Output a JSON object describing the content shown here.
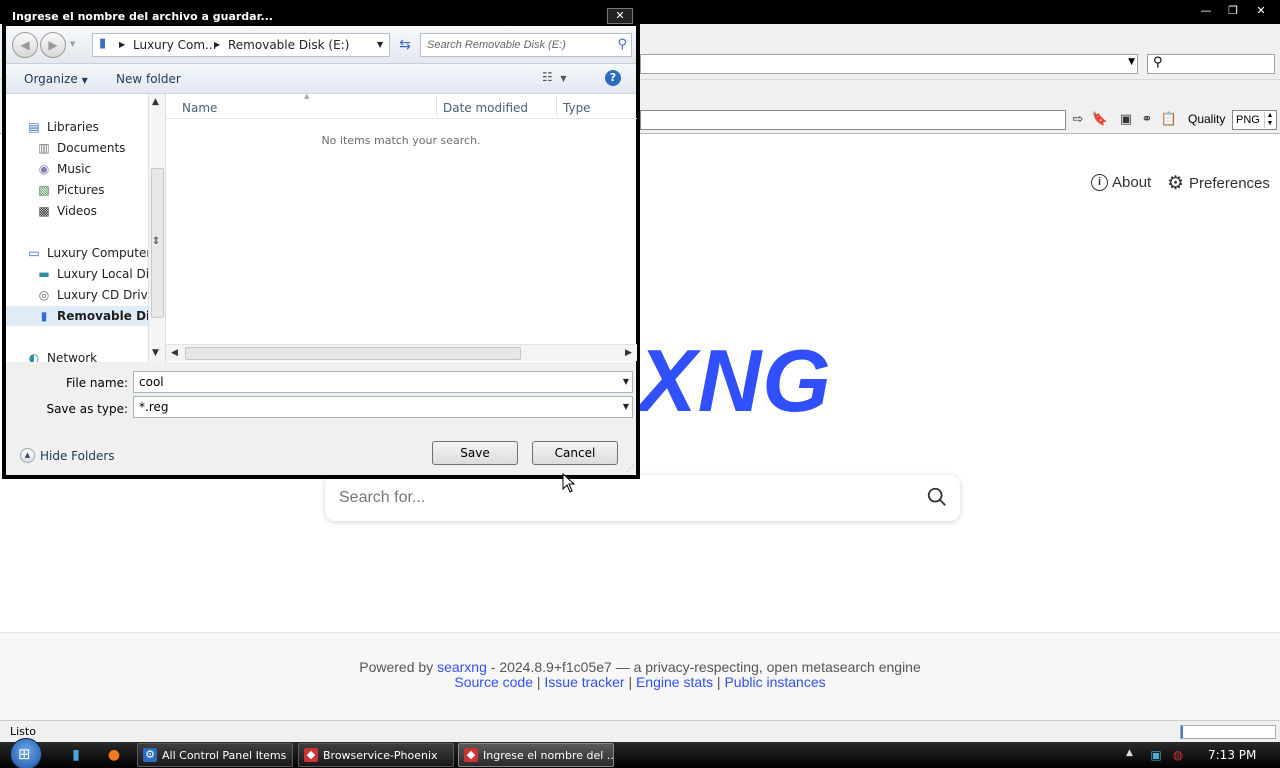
{
  "browser": {
    "window_controls": {
      "minimize": "—",
      "maximize": "❐",
      "close": "✕"
    },
    "quality_label": "Quality",
    "quality_value": "PNG",
    "status_text": "Listo"
  },
  "searxng": {
    "about_label": "About",
    "preferences_label": "Preferences",
    "logo_visible": "XNG",
    "search_placeholder": "Search for...",
    "footer": {
      "powered_by": "Powered by",
      "searxng_link": "searxng",
      "version_text": "- 2024.8.9+f1c05e7 — a privacy-respecting, open metasearch engine",
      "source_code": "Source code",
      "issue_tracker": "Issue tracker",
      "engine_stats": "Engine stats",
      "public_instances": "Public instances",
      "sep": "|"
    },
    "logo_color": "#3050ff"
  },
  "dialog": {
    "title": "Ingrese el nombre del archivo a guardar...",
    "close_glyph": "✕",
    "breadcrumb": [
      "Luxury Com...",
      "Removable Disk (E:)"
    ],
    "search_placeholder": "Search Removable Disk (E:)",
    "organize_label": "Organize",
    "new_folder_label": "New folder",
    "nav_items": [
      {
        "label": "Libraries",
        "icon": "libraries-icon"
      },
      {
        "label": "Documents",
        "icon": "documents-icon"
      },
      {
        "label": "Music",
        "icon": "music-icon"
      },
      {
        "label": "Pictures",
        "icon": "pictures-icon"
      },
      {
        "label": "Videos",
        "icon": "videos-icon"
      },
      {
        "label": "Luxury Computer",
        "icon": "computer-icon"
      },
      {
        "label": "Luxury Local Disk",
        "icon": "local-disk-icon"
      },
      {
        "label": "Luxury CD Drive (",
        "icon": "cd-drive-icon"
      },
      {
        "label": "Removable Disk",
        "icon": "usb-drive-icon",
        "selected": true
      },
      {
        "label": "Network",
        "icon": "network-icon"
      }
    ],
    "columns": [
      "Name",
      "Date modified",
      "Type"
    ],
    "empty_message": "No items match your search.",
    "file_name_label": "File name:",
    "file_name_value": "cool",
    "save_type_label": "Save as type:",
    "save_type_value": "*.reg",
    "hide_folders_label": "Hide Folders",
    "save_label": "Save",
    "cancel_label": "Cancel"
  },
  "taskbar": {
    "tasks": [
      {
        "label": "All Control Panel Items",
        "icon": "control-panel-icon"
      },
      {
        "label": "Browservice-Phoenix",
        "icon": "browservice-icon"
      },
      {
        "label": "Ingrese el nombre del ...",
        "icon": "browservice-icon",
        "active": true
      }
    ],
    "clock": "7:13 PM"
  }
}
